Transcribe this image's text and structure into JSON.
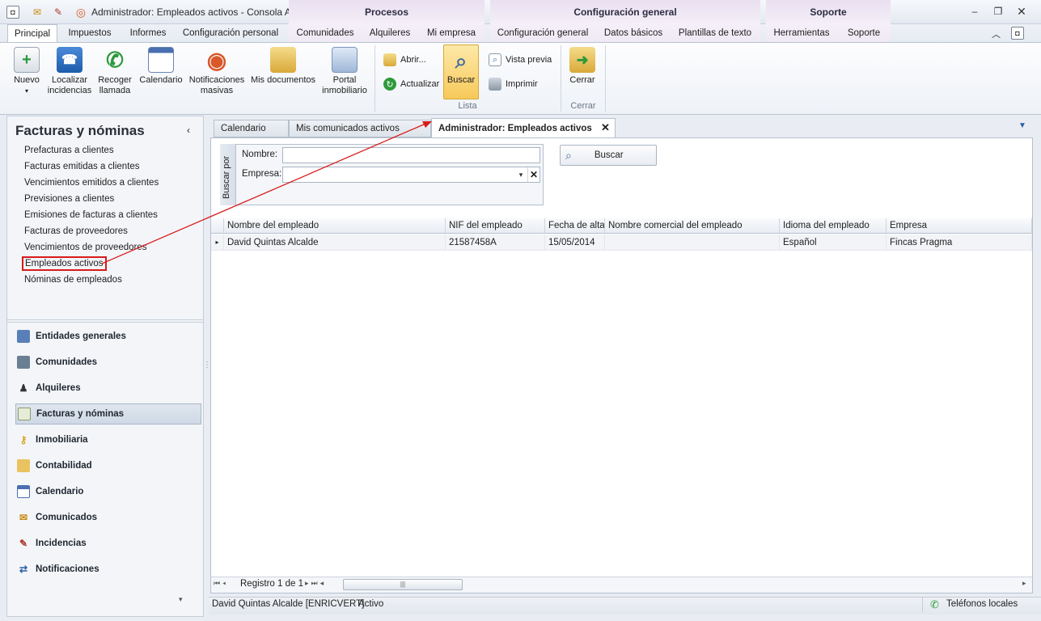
{
  "window": {
    "title": "Administrador: Empleados activos - Consola AD...",
    "ctx_groups": [
      "Procesos",
      "Configuración general",
      "Soporte"
    ]
  },
  "tabs": [
    "Principal",
    "Impuestos",
    "Informes",
    "Configuración personal",
    "Comunidades",
    "Alquileres",
    "Mi empresa",
    "Configuración general",
    "Datos básicos",
    "Plantillas de texto",
    "Herramientas",
    "Soporte"
  ],
  "ribbon": {
    "nuevo": "Nuevo",
    "localizar": "Localizar\nincidencias",
    "recoger": "Recoger\nllamada",
    "calendario": "Calendario",
    "notificaciones": "Notificaciones\nmasivas",
    "documentos": "Mis documentos",
    "portal": "Portal\ninmobiliario",
    "abrir": "Abrir...",
    "actualizar": "Actualizar",
    "buscar": "Buscar",
    "vista_previa": "Vista previa",
    "imprimir": "Imprimir",
    "group_lista": "Lista",
    "cerrar": "Cerrar",
    "group_cerrar": "Cerrar"
  },
  "nav": {
    "title": "Facturas y nóminas",
    "items": [
      "Prefacturas a clientes",
      "Facturas emitidas a clientes",
      "Vencimientos emitidos a clientes",
      "Previsiones a clientes",
      "Emisiones de facturas a clientes",
      "Facturas de proveedores",
      "Vencimientos de proveedores",
      "Empleados activos",
      "Nóminas de empleados"
    ],
    "modules": [
      "Entidades generales",
      "Comunidades",
      "Alquileres",
      "Facturas y nóminas",
      "Inmobiliaria",
      "Contabilidad",
      "Calendario",
      "Comunicados",
      "Incidencias",
      "Notificaciones"
    ]
  },
  "doc_tabs": [
    "Calendario",
    "Mis comunicados activos",
    "Administrador: Empleados activos"
  ],
  "search": {
    "vertical_label": "Buscar por",
    "nombre_label": "Nombre:",
    "empresa_label": "Empresa:",
    "nombre_value": "",
    "empresa_value": "",
    "button": "Buscar"
  },
  "grid": {
    "columns": [
      "Nombre del empleado",
      "NIF del empleado",
      "Fecha de alta",
      "Nombre comercial del empleado",
      "Idioma del empleado",
      "Empresa"
    ],
    "rows": [
      [
        "David Quintas Alcalde",
        "21587458A",
        "15/05/2014",
        "",
        "Español",
        "Fincas Pragma"
      ]
    ],
    "pager": "Registro 1 de 1"
  },
  "status": {
    "user": "David Quintas Alcalde [ENRICVERT]",
    "state": "Activo",
    "phones": "Teléfonos locales"
  },
  "colors": {
    "accent_red": "#d81b1b",
    "ctx_purple": "#e9dff0"
  }
}
